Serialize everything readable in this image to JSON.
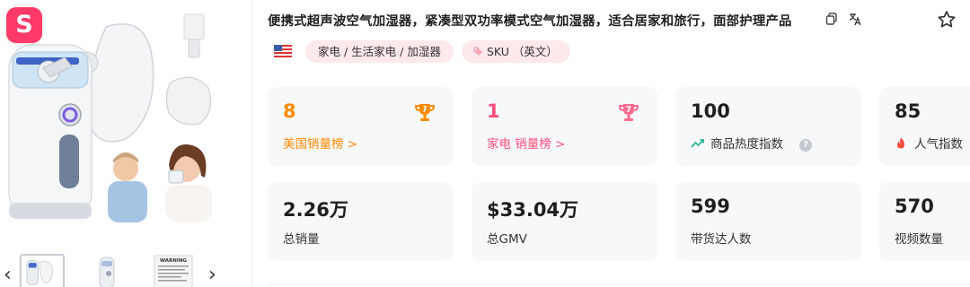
{
  "product": {
    "title": "便携式超声波空气加湿器，紧凑型双功率模式空气加湿器，适合居家和旅行，面部护理产品",
    "logo_letter": "S",
    "thumb_warning_text": "WARNING"
  },
  "tags": {
    "country_flag": "us-flag-icon",
    "category": "家电 / 生活家电 / 加湿器",
    "sku": "SKU （英文）"
  },
  "stats": {
    "us_rank": {
      "value": "8",
      "label": "美国销量榜 >"
    },
    "cat_rank": {
      "value": "1",
      "label": "家电 销量榜 >"
    },
    "heat": {
      "value": "100",
      "label": "商品热度指数",
      "help": "?"
    },
    "popularity": {
      "value": "85",
      "label": "人气指数"
    },
    "total_sales": {
      "value": "2.26万",
      "label": "总销量"
    },
    "gmv": {
      "value": "$33.04万",
      "label": "总GMV"
    },
    "creators": {
      "value": "599",
      "label": "带货达人数"
    },
    "videos": {
      "value": "570",
      "label": "视频数量"
    }
  },
  "colors": {
    "accent_pink": "#ff4f7b",
    "accent_orange": "#ff8a00",
    "tag_bg": "#fde8ec",
    "card_bg": "#f7f8fa"
  },
  "nav": {
    "prev": "‹",
    "next": "›"
  }
}
